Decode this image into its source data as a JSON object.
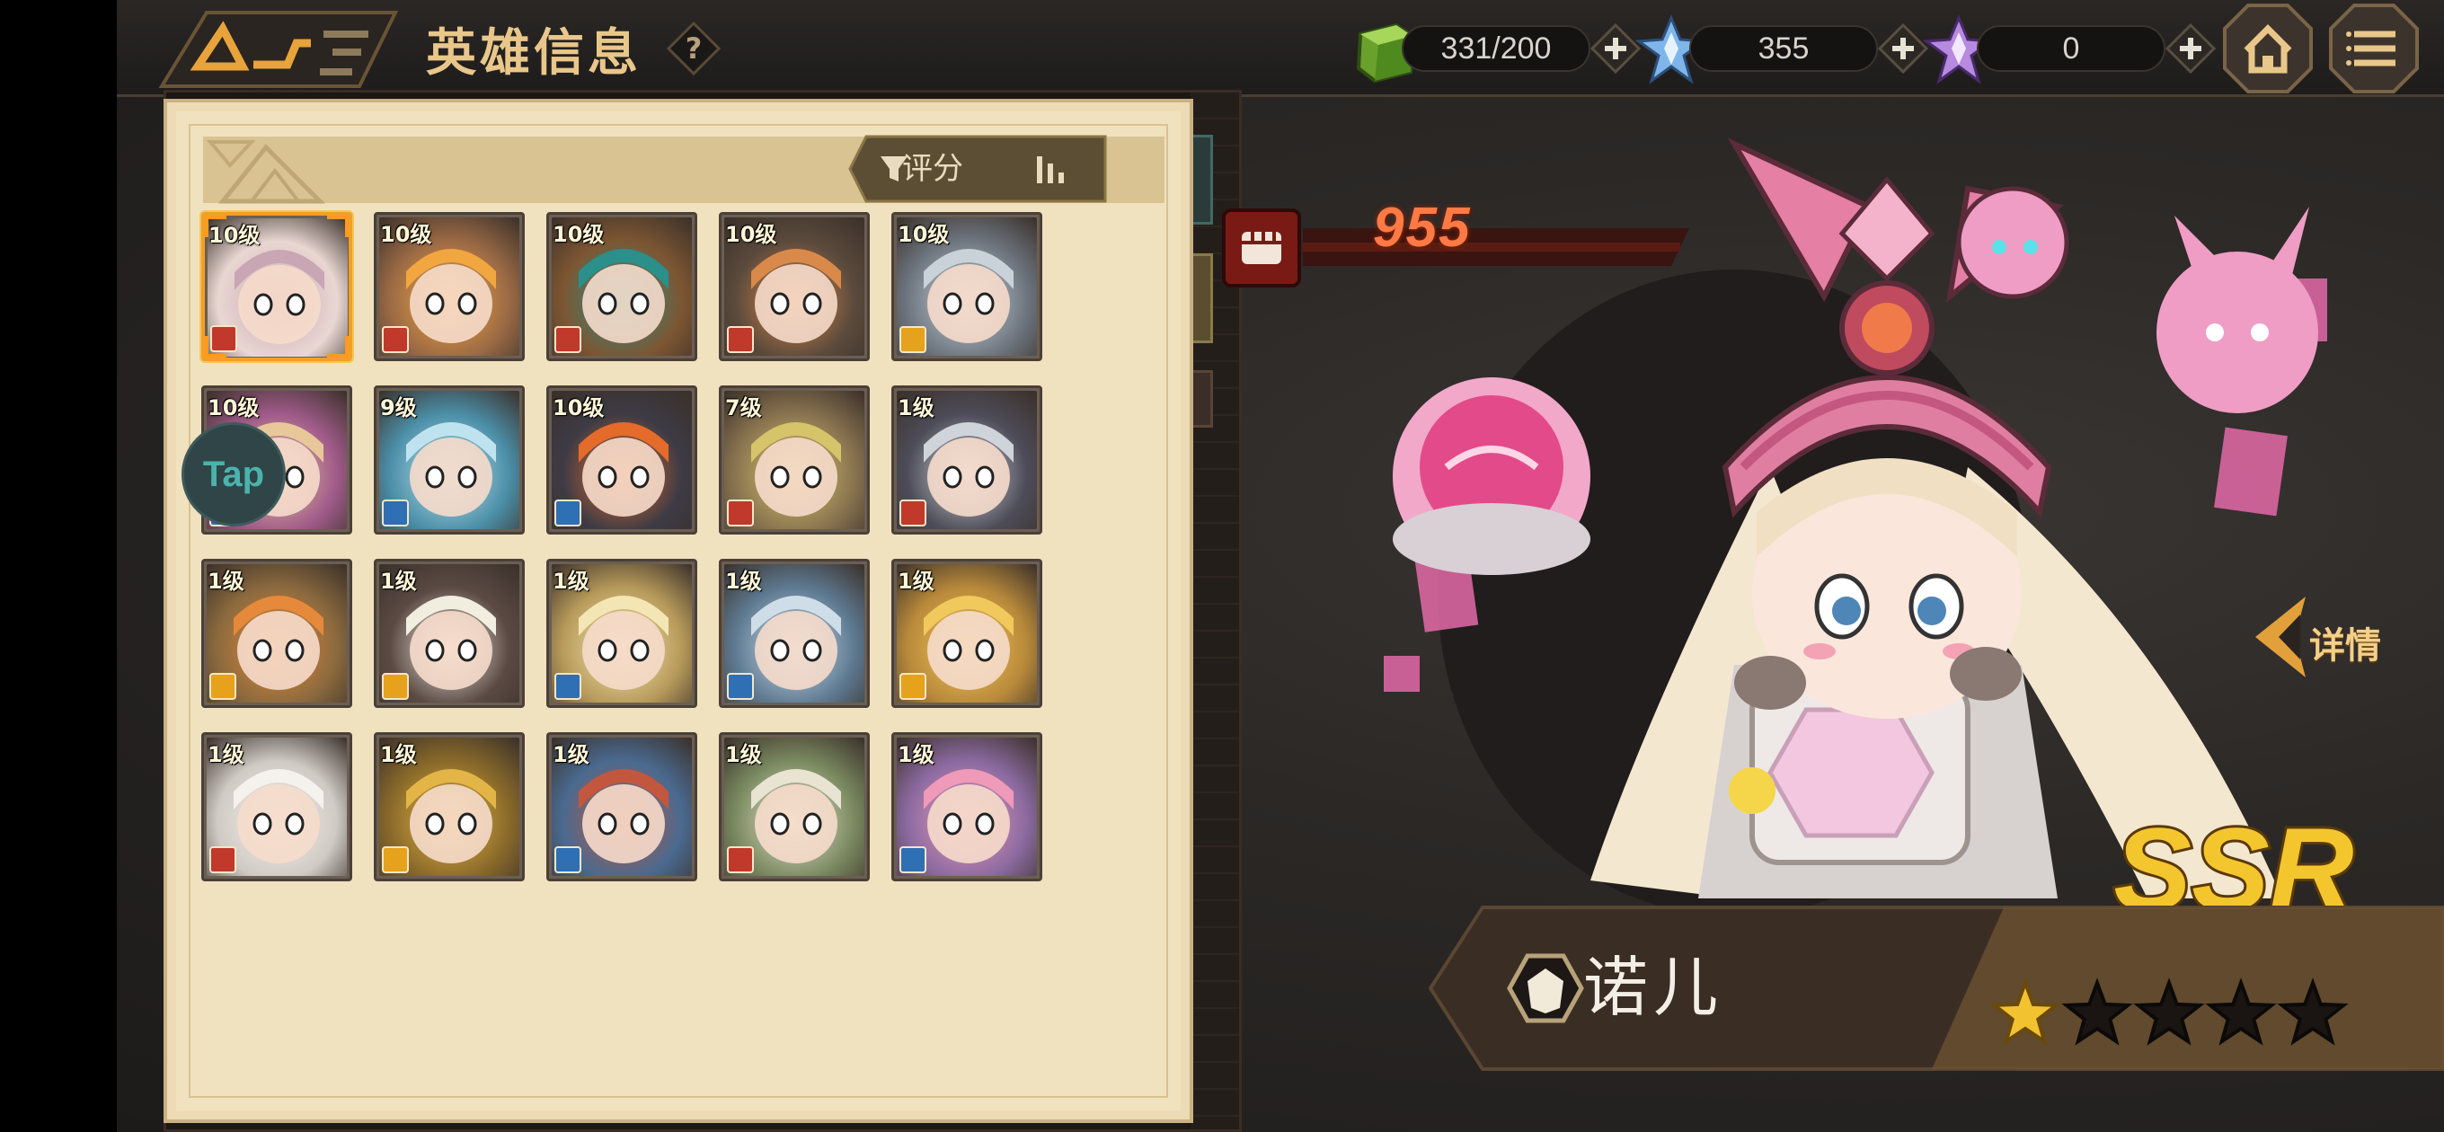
{
  "header": {
    "title": "英雄信息",
    "help_symbol": "?"
  },
  "resources": [
    {
      "name": "stamina",
      "icon": "green-cube-icon",
      "value": "331/200"
    },
    {
      "name": "diamond",
      "icon": "blue-crystal-icon",
      "value": "355"
    },
    {
      "name": "premium",
      "icon": "purple-crystal-icon",
      "value": "0"
    }
  ],
  "tap_label": "Tap",
  "panel": {
    "sort_label": "评分"
  },
  "heroes": [
    {
      "level": "10级",
      "portrait": "#e9d7d2",
      "accent": "#c9a6b3",
      "cls": "#c0392b",
      "selected": true
    },
    {
      "level": "10级",
      "portrait": "#9b6a45",
      "accent": "#f2a640",
      "cls": "#c0392b"
    },
    {
      "level": "10级",
      "portrait": "#7d5632",
      "accent": "#2b8f8a",
      "cls": "#c0392b"
    },
    {
      "level": "10级",
      "portrait": "#5b4a3c",
      "accent": "#d9894a",
      "cls": "#c0392b"
    },
    {
      "level": "10级",
      "portrait": "#6e7680",
      "accent": "#c8d2d8",
      "cls": "#e6a21c"
    },
    {
      "level": "10级",
      "portrait": "#a05b8a",
      "accent": "#e8c89a",
      "cls": "#2f6fb3"
    },
    {
      "level": "9级",
      "portrait": "#4b8fa8",
      "accent": "#bfe3ee",
      "cls": "#2f6fb3"
    },
    {
      "level": "10级",
      "portrait": "#3d3b45",
      "accent": "#e46b2a",
      "cls": "#2f6fb3"
    },
    {
      "level": "7级",
      "portrait": "#8a7450",
      "accent": "#d6c46a",
      "cls": "#c0392b"
    },
    {
      "level": "1级",
      "portrait": "#4d4c58",
      "accent": "#cfd3da",
      "cls": "#c0392b"
    },
    {
      "level": "1级",
      "portrait": "#8c6a3e",
      "accent": "#e58a3a",
      "cls": "#e6a21c"
    },
    {
      "level": "1级",
      "portrait": "#5b4a44",
      "accent": "#f1eee0",
      "cls": "#e6a21c"
    },
    {
      "level": "1级",
      "portrait": "#b79a5a",
      "accent": "#f4e6b4",
      "cls": "#2f6fb3"
    },
    {
      "level": "1级",
      "portrait": "#5e7a92",
      "accent": "#cfdde8",
      "cls": "#2f6fb3"
    },
    {
      "level": "1级",
      "portrait": "#b8893a",
      "accent": "#f0c85c",
      "cls": "#e6a21c"
    },
    {
      "level": "1级",
      "portrait": "#cfcac4",
      "accent": "#f5f2ee",
      "cls": "#c0392b"
    },
    {
      "level": "1级",
      "portrait": "#8a6a2a",
      "accent": "#e2b546",
      "cls": "#e6a21c"
    },
    {
      "level": "1级",
      "portrait": "#4a6a90",
      "accent": "#c2573e",
      "cls": "#2f6fb3"
    },
    {
      "level": "1级",
      "portrait": "#7a8a60",
      "accent": "#e9e3d2",
      "cls": "#c0392b"
    },
    {
      "level": "1级",
      "portrait": "#8b6aa0",
      "accent": "#ee9ab8",
      "cls": "#2f6fb3"
    }
  ],
  "selected_hero": {
    "power": "955",
    "name": "诺儿",
    "rarity": "SSR",
    "stars_filled": 1,
    "stars_total": 5,
    "detail_label": "详情"
  },
  "colors": {
    "gold": "#e9c78a",
    "panel_bg": "#f1e2bf",
    "power": "#ff7a45",
    "pink": "#e9799f"
  }
}
